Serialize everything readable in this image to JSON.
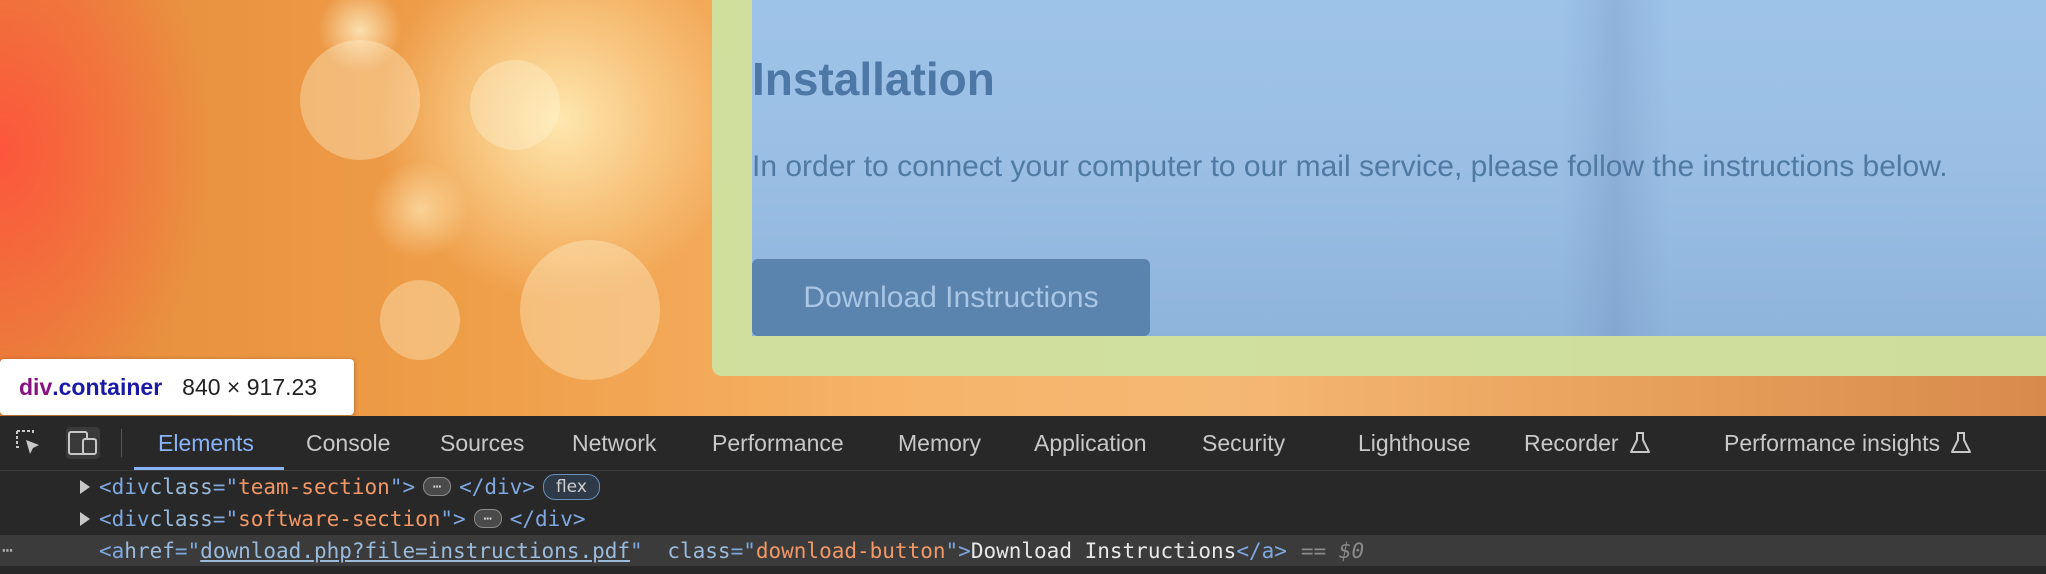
{
  "page": {
    "title": "Installation",
    "text": "In order to connect your computer to our mail service, please follow the instructions below.",
    "download_button": "Download Instructions"
  },
  "tooltip": {
    "tag": "div",
    "class": ".container",
    "size": "840 × 917.23"
  },
  "devtools": {
    "tabs": [
      {
        "label": "Elements"
      },
      {
        "label": "Console"
      },
      {
        "label": "Sources"
      },
      {
        "label": "Network"
      },
      {
        "label": "Performance"
      },
      {
        "label": "Memory"
      },
      {
        "label": "Application"
      },
      {
        "label": "Security"
      },
      {
        "label": "Lighthouse"
      },
      {
        "label": "Recorder"
      },
      {
        "label": "Performance insights"
      }
    ],
    "active_tab": "Elements",
    "dom": {
      "line1": {
        "open": "<div ",
        "attr": "class",
        "eq": "=\"",
        "val": "team-section",
        "q": "\">",
        "close": "</div>",
        "badge": "flex"
      },
      "line2": {
        "open": "<div ",
        "attr": "class",
        "eq": "=\"",
        "val": "software-section",
        "q": "\">",
        "close": "</div>"
      },
      "line3": {
        "open": "<a ",
        "attr1": "href",
        "eq1": "=\"",
        "href": "download.php?file=instructions.pdf",
        "q1": "\" ",
        "attr2": "class",
        "eq2": "=\"",
        "val2": "download-button",
        "q2": "\">",
        "text": "Download Instructions",
        "close": "</a>",
        "marker": "== $0"
      },
      "ellipsis": "⋯",
      "row_dots": "⋯"
    }
  },
  "colors": {
    "accent": "#8ab4f8",
    "margin_overlay": "#cde2a0",
    "content_overlay": "#9ec3e9"
  }
}
